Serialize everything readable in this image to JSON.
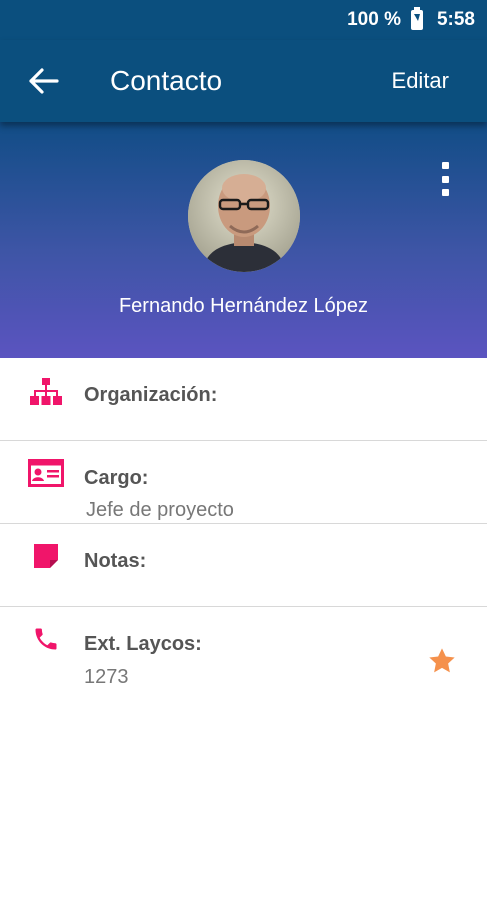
{
  "status_bar": {
    "battery": "100 %",
    "time": "5:58"
  },
  "app_bar": {
    "title": "Contacto",
    "edit_label": "Editar"
  },
  "contact": {
    "name": "Fernando Hernández López"
  },
  "fields": [
    {
      "label": "Organización:",
      "value": "",
      "icon": "org-chart-icon"
    },
    {
      "label": "Cargo:",
      "value": "Jefe de proyecto",
      "icon": "id-card-icon"
    },
    {
      "label": "Notas:",
      "value": "",
      "icon": "note-icon"
    },
    {
      "label": "Ext. Laycos:",
      "value": "1273",
      "icon": "phone-icon"
    }
  ],
  "colors": {
    "bar": "#0b4f7e",
    "accent_pink": "#f0156a",
    "star": "#f5914c",
    "gradient_end": "#5b54c0"
  }
}
